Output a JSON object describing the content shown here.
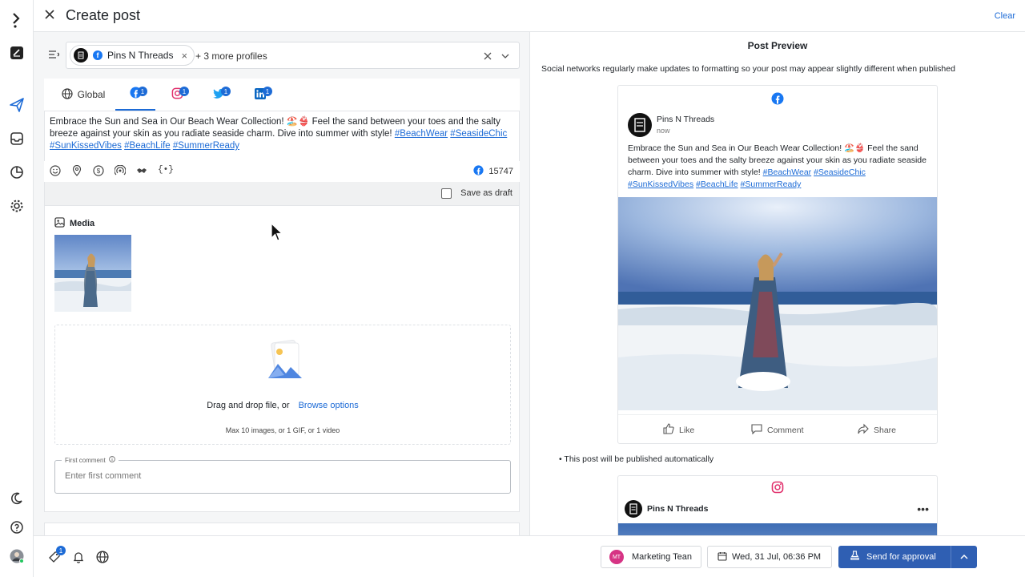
{
  "header": {
    "title": "Create post",
    "clear_label": "Clear"
  },
  "rail": {
    "icons": [
      "logo-icon",
      "compose-icon",
      "send-icon",
      "inbox-icon",
      "analytics-icon",
      "settings-icon",
      "moon-icon",
      "help-icon",
      "user-avatar"
    ]
  },
  "profiles": {
    "selected_name": "Pins N Threads",
    "more_label": "+ 3 more profiles"
  },
  "tabs": [
    {
      "label": "Global",
      "icon": "globe-icon"
    },
    {
      "label": "",
      "icon": "facebook-icon",
      "badge": "1",
      "active": true
    },
    {
      "label": "",
      "icon": "instagram-icon",
      "badge": "1"
    },
    {
      "label": "",
      "icon": "twitter-icon",
      "badge": "1"
    },
    {
      "label": "",
      "icon": "linkedin-icon",
      "badge": "1"
    }
  ],
  "composer": {
    "text": "Embrace the Sun and Sea in Our Beach Wear Collection! 🏖️👙 Feel the sand between your toes and the salty breeze against your skin as you radiate seaside charm. Dive into summer with style!",
    "hashtags": [
      "#BeachWear",
      "#SeasideChic",
      "#SunKissedVibes",
      "#BeachLife",
      "#SummerReady"
    ],
    "char_count": "15747"
  },
  "draft": {
    "label": "Save as draft"
  },
  "media": {
    "heading": "Media",
    "drop_text": "Drag and drop file, or",
    "browse_label": "Browse options",
    "hint": "Max 10 images, or 1 GIF, or 1 video",
    "first_comment_label": "First comment",
    "first_comment_placeholder": "Enter first comment"
  },
  "preview": {
    "title": "Post Preview",
    "note": "Social networks regularly make updates to formatting so your post may appear slightly different when published",
    "fb": {
      "name": "Pins N Threads",
      "time": "now",
      "text": "Embrace the Sun and Sea in Our Beach Wear Collection! 🏖️👙 Feel the sand between your toes and the salty breeze against your skin as you radiate seaside charm. Dive into summer with style!",
      "like": "Like",
      "comment": "Comment",
      "share": "Share"
    },
    "auto_note": "This post will be published automatically",
    "ig": {
      "name": "Pins N Threads",
      "more": "•••"
    }
  },
  "footer": {
    "team_label": "Marketing Tean",
    "team_initials": "MT",
    "tag_badge": "1",
    "date_label": "Wed, 31 Jul, 06:36 PM",
    "send_label": "Send for approval"
  },
  "colors": {
    "accent": "#1d6bd6",
    "facebook": "#1877f2",
    "instagram": "#e1306c",
    "twitter": "#1da1f2",
    "linkedin": "#0a66c2",
    "send": "#2f5fb3"
  }
}
